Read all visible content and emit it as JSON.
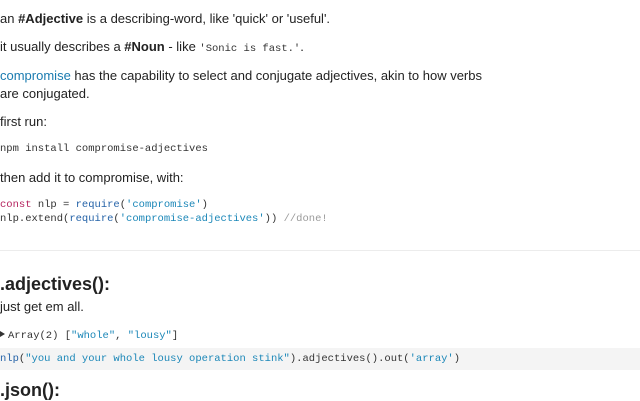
{
  "intro": {
    "p1": {
      "pre": "an ",
      "bold": "#Adjective",
      "post": " is a describing-word, like 'quick' or 'useful'."
    },
    "p2": {
      "pre": "it usually describes a ",
      "bold": "#Noun",
      "mid": " - like ",
      "code": "'Sonic is fast.'",
      "post": "."
    },
    "p3": {
      "link": "compromise",
      "line1": " has the capability to select and conjugate adjectives, akin to how verbs",
      "line2": "are conjugated."
    },
    "p4": "first run:",
    "install_cmd": "npm install compromise-adjectives",
    "p5": "then add it to compromise, with:"
  },
  "setup_code": {
    "l1_kw": "const",
    "l1_var": " nlp = ",
    "l1_fn": "require",
    "l1_open": "(",
    "l1_str": "'compromise'",
    "l1_close": ")",
    "l2_pre": "nlp.extend(",
    "l2_fn": "require",
    "l2_open": "(",
    "l2_str": "'compromise-adjectives'",
    "l2_close": ")) ",
    "l2_cmt": "//done!"
  },
  "section_adjectives": {
    "heading": ".adjectives():",
    "desc": "just get em all.",
    "output_label": "Array(2) [",
    "output_items": [
      "\"whole\"",
      "\"lousy\""
    ],
    "output_sep": ", ",
    "output_end": "]",
    "code_fn": "nlp",
    "code_open": "(",
    "code_str": "\"you and your whole lousy operation stink\"",
    "code_mid": ").adjectives().out(",
    "code_arg": "'array'",
    "code_end": ")"
  },
  "section_json": {
    "heading": ".json():"
  }
}
